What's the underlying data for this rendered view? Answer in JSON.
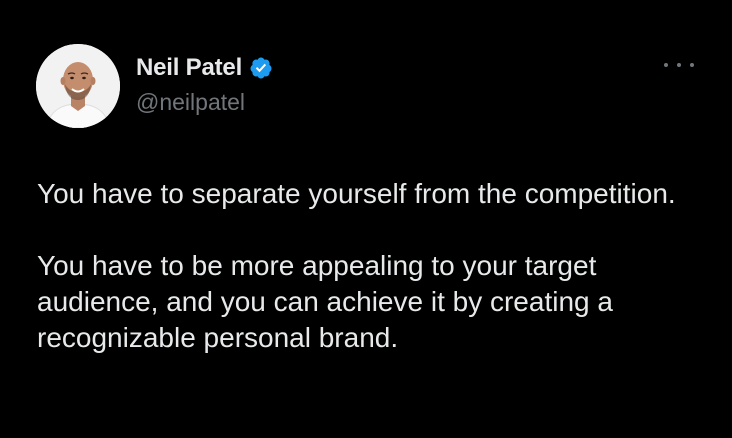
{
  "author": {
    "display_name": "Neil Patel",
    "handle": "@neilpatel",
    "verified": true,
    "avatar_icon": "profile-photo"
  },
  "menu": {
    "icon": "more-horizontal-icon"
  },
  "tweet": {
    "paragraphs": [
      "You have to separate yourself from the competition.",
      "You have to be more appealing to your target audience, and you can achieve it by creating a recognizable personal brand."
    ]
  },
  "colors": {
    "background": "#000000",
    "text_primary": "#e7e9ea",
    "text_secondary": "#71767b",
    "verified_badge": "#1d9bf0"
  }
}
